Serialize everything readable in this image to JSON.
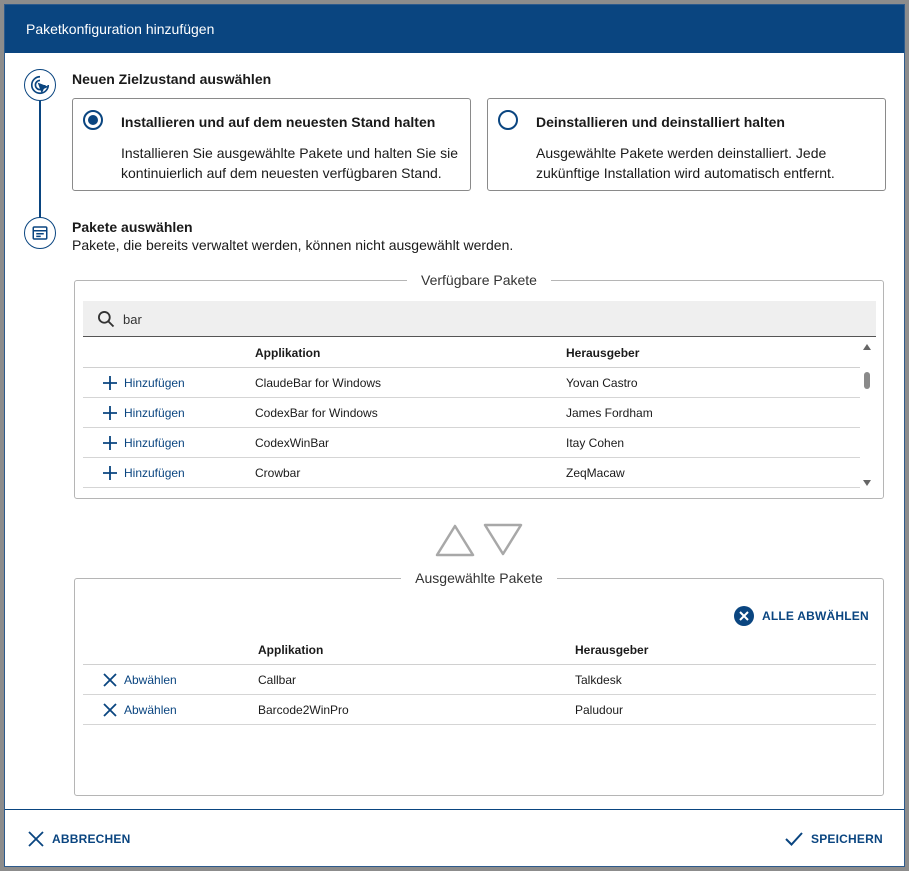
{
  "dialog": {
    "title": "Paketkonfiguration hinzufügen"
  },
  "step1": {
    "title": "Neuen Zielzustand auswählen",
    "options": [
      {
        "title": "Installieren und auf dem neuesten Stand halten",
        "description": "Installieren Sie ausgewählte Pakete und halten Sie sie kontinuierlich auf dem neuesten verfügbaren Stand.",
        "selected": true
      },
      {
        "title": "Deinstallieren und deinstalliert halten",
        "description": "Ausgewählte Pakete werden deinstalliert. Jede zukünftige Installation wird automatisch entfernt.",
        "selected": false
      }
    ]
  },
  "step2": {
    "title": "Pakete auswählen",
    "subtitle": "Pakete, die bereits verwaltet werden, können nicht ausgewählt werden."
  },
  "available": {
    "legend": "Verfügbare Pakete",
    "search_value": "bar",
    "columns": {
      "application": "Applikation",
      "publisher": "Herausgeber"
    },
    "action_label": "Hinzufügen",
    "rows": [
      {
        "application": "ClaudeBar for Windows",
        "publisher": "Yovan Castro"
      },
      {
        "application": "CodexBar for Windows",
        "publisher": "James Fordham"
      },
      {
        "application": "CodexWinBar",
        "publisher": "Itay Cohen"
      },
      {
        "application": "Crowbar",
        "publisher": "ZeqMacaw"
      }
    ]
  },
  "selected": {
    "legend": "Ausgewählte Pakete",
    "deselect_all_label": "ALLE ABWÄHLEN",
    "columns": {
      "application": "Applikation",
      "publisher": "Herausgeber"
    },
    "action_label": "Abwählen",
    "rows": [
      {
        "application": "Callbar",
        "publisher": "Talkdesk"
      },
      {
        "application": "Barcode2WinPro",
        "publisher": "Paludour"
      }
    ]
  },
  "footer": {
    "cancel_label": "ABBRECHEN",
    "save_label": "SPEICHERN"
  },
  "colors": {
    "primary": "#0a4580",
    "border": "#8a8a8a",
    "search_bg": "#efefef"
  },
  "icons": [
    "target-cursor-icon",
    "list-window-icon",
    "search-icon",
    "plus-icon",
    "close-icon",
    "close-circle-icon",
    "check-icon",
    "arrow-up-icon",
    "arrow-down-icon"
  ]
}
